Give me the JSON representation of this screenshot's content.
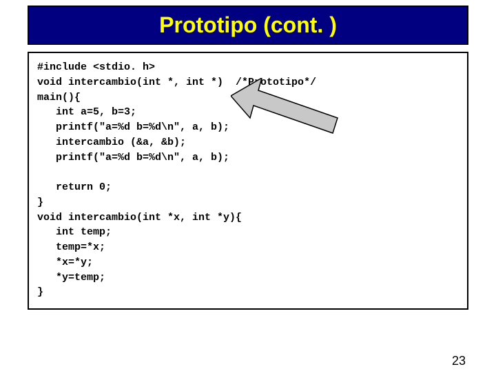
{
  "title": "Prototipo (cont. )",
  "page_number": "23",
  "code": "#include <stdio. h>\nvoid intercambio(int *, int *)  /*Prototipo*/\nmain(){\n   int a=5, b=3;\n   printf(\"a=%d b=%d\\n\", a, b);\n   intercambio (&a, &b);\n   printf(\"a=%d b=%d\\n\", a, b);\n\n   return 0;\n}\nvoid intercambio(int *x, int *y){\n   int temp;\n   temp=*x;\n   *x=*y;\n   *y=temp;\n}",
  "arrow": {
    "fill": "#c8c8c8",
    "stroke": "#000000"
  }
}
